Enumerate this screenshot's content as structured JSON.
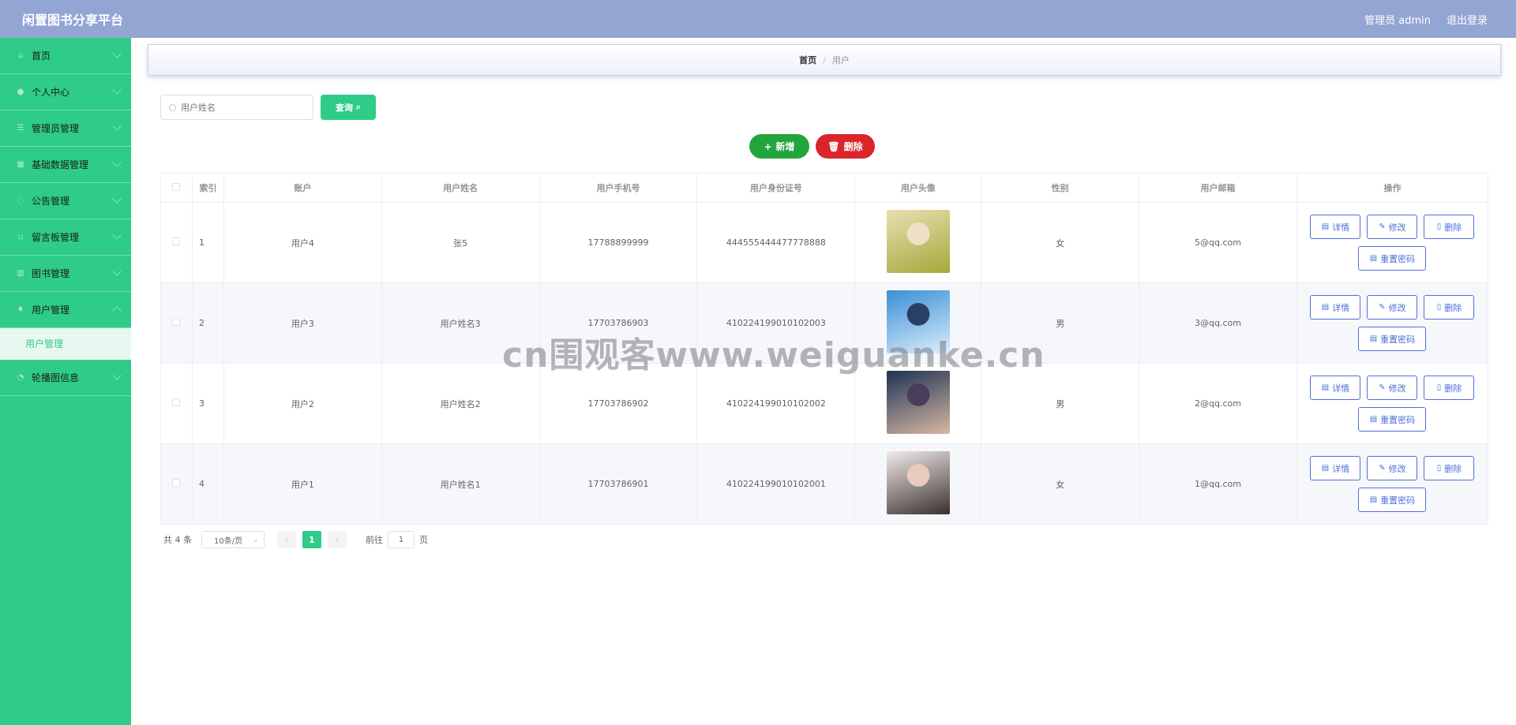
{
  "header": {
    "title": "闲置图书分享平台",
    "user_label": "管理员 admin",
    "logout_label": "退出登录"
  },
  "sidebar": {
    "items": [
      {
        "label": "首页",
        "icon": "home-icon"
      },
      {
        "label": "个人中心",
        "icon": "user-icon"
      },
      {
        "label": "管理员管理",
        "icon": "list-icon"
      },
      {
        "label": "基础数据管理",
        "icon": "grid-icon"
      },
      {
        "label": "公告管理",
        "icon": "bell-icon"
      },
      {
        "label": "留言板管理",
        "icon": "message-icon"
      },
      {
        "label": "图书管理",
        "icon": "book-icon"
      },
      {
        "label": "用户管理",
        "icon": "person-icon",
        "submenu": "用户管理"
      },
      {
        "label": "轮播图信息",
        "icon": "image-icon"
      }
    ]
  },
  "breadcrumb": {
    "home": "首页",
    "separator": "/",
    "current": "用户"
  },
  "search": {
    "placeholder": "用户姓名",
    "button_label": "查询"
  },
  "actions": {
    "add_label": "新增",
    "delete_label": "删除"
  },
  "table": {
    "headers": [
      "索引",
      "账户",
      "用户姓名",
      "用户手机号",
      "用户身份证号",
      "用户头像",
      "性别",
      "用户邮箱",
      "操作"
    ],
    "rows": [
      {
        "index": "1",
        "account": "用户4",
        "name": "张5",
        "phone": "17788899999",
        "id_card": "444555444477778888",
        "avatar_colors": [
          "#e9dfb1",
          "#a5a83a",
          "#f0e0c8"
        ],
        "gender": "女",
        "email": "5@qq.com"
      },
      {
        "index": "2",
        "account": "用户3",
        "name": "用户姓名3",
        "phone": "17703786903",
        "id_card": "410224199010102003",
        "avatar_colors": [
          "#3a8fd6",
          "#dbeefb",
          "#2b3f66"
        ],
        "gender": "男",
        "email": "3@qq.com"
      },
      {
        "index": "3",
        "account": "用户2",
        "name": "用户姓名2",
        "phone": "17703786902",
        "id_card": "410224199010102002",
        "avatar_colors": [
          "#1e3356",
          "#d8b7a2",
          "#4a3c5c"
        ],
        "gender": "男",
        "email": "2@qq.com"
      },
      {
        "index": "4",
        "account": "用户1",
        "name": "用户姓名1",
        "phone": "17703786901",
        "id_card": "410224199010102001",
        "avatar_colors": [
          "#f1eceb",
          "#3b2f2f",
          "#e8cbbd"
        ],
        "gender": "女",
        "email": "1@qq.com"
      }
    ],
    "op_labels": {
      "detail": "详情",
      "edit": "修改",
      "delete": "删除",
      "reset": "重置密码"
    }
  },
  "pagination": {
    "total": "共 4 条",
    "page_size": "10条/页",
    "current_page": "1",
    "goto_label": "前往",
    "goto_value": "1",
    "page_unit": "页"
  },
  "watermark": "cn围观客www.weiguanke.cn",
  "colors": {
    "accent": "#2ecc87",
    "header": "#93a5d3",
    "add": "#23a53d",
    "delete": "#d9262a",
    "op": "#4f6fd8"
  }
}
